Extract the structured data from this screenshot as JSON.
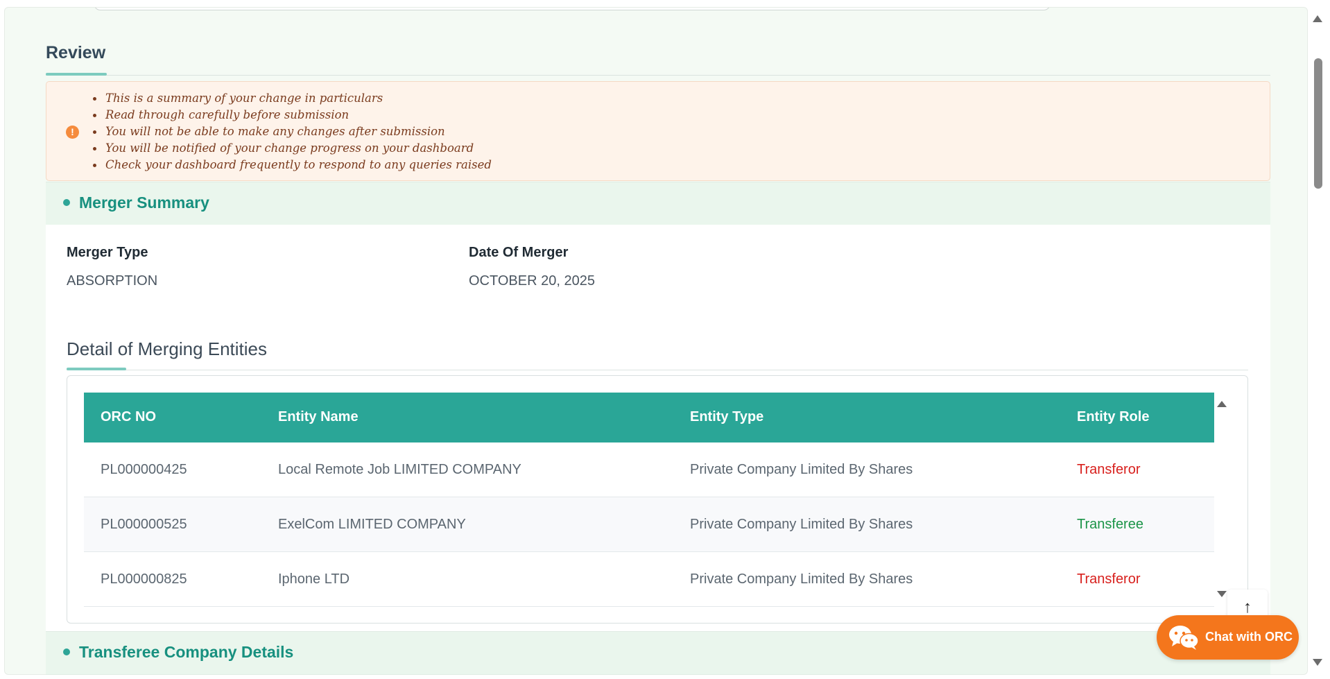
{
  "review": {
    "title": "Review",
    "notices": [
      "This is a summary of your change in particulars",
      "Read through carefully before submission",
      "You will not be able to make any changes after submission",
      "You will be notified of your change progress on your dashboard",
      "Check your dashboard frequently to respond to any queries raised"
    ]
  },
  "merger_summary": {
    "title": "Merger Summary",
    "merger_type_label": "Merger Type",
    "merger_type_value": "ABSORPTION",
    "date_label": "Date Of Merger",
    "date_value": "OCTOBER 20, 2025"
  },
  "entities": {
    "title": "Detail of Merging Entities",
    "columns": [
      "ORC NO",
      "Entity Name",
      "Entity Type",
      "Entity Role"
    ],
    "rows": [
      {
        "orc": "PL000000425",
        "name": "Local Remote Job LIMITED COMPANY",
        "type": "Private Company Limited By Shares",
        "role": "Transferor"
      },
      {
        "orc": "PL000000525",
        "name": "ExelCom LIMITED COMPANY",
        "type": "Private Company Limited By Shares",
        "role": "Transferee"
      },
      {
        "orc": "PL000000825",
        "name": "Iphone LTD",
        "type": "Private Company Limited By Shares",
        "role": "Transferor"
      }
    ]
  },
  "transferee_section": {
    "title": "Transferee Company Details"
  },
  "chat": {
    "label": "Chat with ORC",
    "icon": "wechat-icon"
  },
  "back_to_top": {
    "icon": "arrow-up-icon",
    "glyph": "↑"
  },
  "colors": {
    "accent": "#2aa697",
    "transferor": "#d8201d",
    "transferee": "#1b9447",
    "chat": "#f4761c",
    "notice_bg": "#fef3ea"
  }
}
